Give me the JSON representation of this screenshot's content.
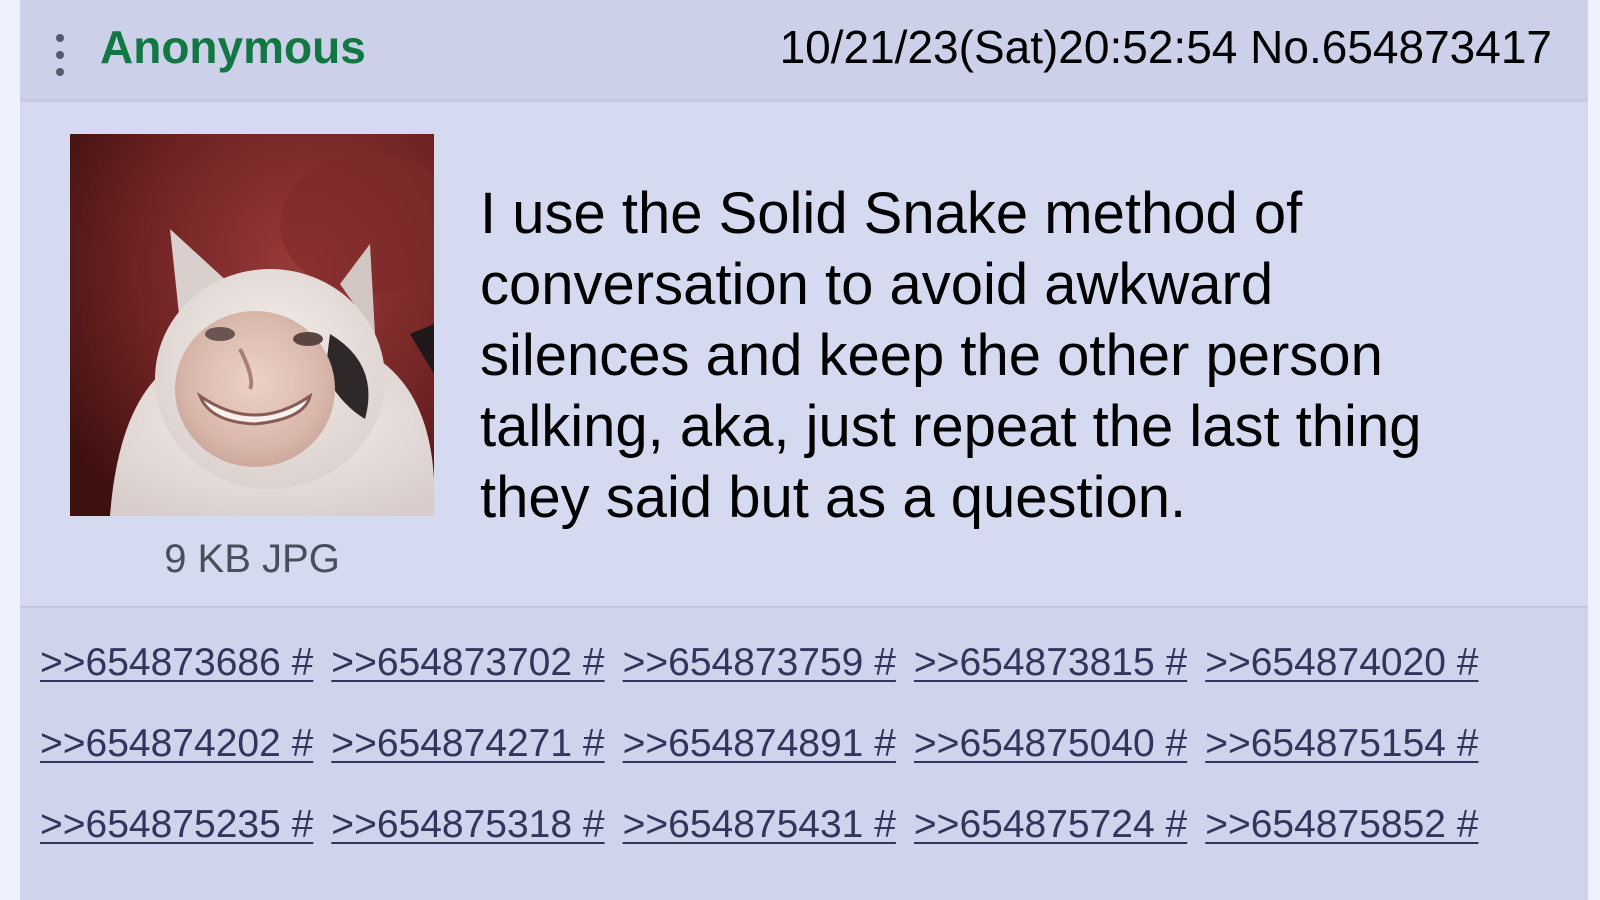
{
  "post": {
    "name": "Anonymous",
    "datetime": "10/21/23(Sat)20:52:54",
    "number": "No.654873417",
    "file_info": "9 KB JPG",
    "comment_lines": [
      "I use the Solid Snake method of",
      "conversation to avoid awkward",
      "silences and keep the other person",
      "talking, aka, just repeat the last thing",
      "they said but as a question."
    ],
    "menu_icon": "vertical-ellipsis-icon"
  },
  "replies": [
    [
      ">>654873686 #",
      ">>654873702 #",
      ">>654873759 #",
      ">>654873815 #",
      ">>654874020 #"
    ],
    [
      ">>654874202 #",
      ">>654874271 #",
      ">>654874891 #",
      ">>654875040 #",
      ">>654875154 #"
    ],
    [
      ">>654875235 #",
      ">>654875318 #",
      ">>654875431 #",
      ">>654875724 #",
      ">>654875852 #"
    ]
  ],
  "colors": {
    "name": "#117743",
    "post_bg": "#d6daf0",
    "header_bg": "#ccd0e8",
    "reply_link": "#34345c"
  }
}
